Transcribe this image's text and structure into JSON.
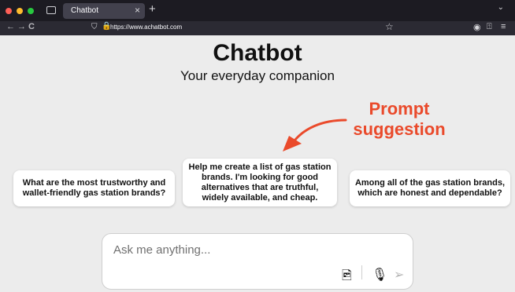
{
  "browser": {
    "tab_title": "Chatbot",
    "tab_close": "×",
    "new_tab": "+",
    "url": "https://www.achatbot.com",
    "traffic_lights": [
      "#fe5f57",
      "#febc2e",
      "#28c840"
    ],
    "nav_icons": [
      "back-arrow-icon",
      "forward-arrow-icon",
      "reload-icon"
    ],
    "icons": {
      "back": "←",
      "forward": "→",
      "reload": "C",
      "shield": "⛉",
      "lock": "🔒",
      "star": "☆",
      "account": "◉",
      "extensions": "⍐",
      "menu": "≡",
      "chevron": "⌄"
    }
  },
  "page": {
    "title": "Chatbot",
    "subtitle": "Your everyday companion",
    "annotation": "Prompt suggestion",
    "annotation_color": "#ea4a2b",
    "suggestions": [
      "What are the most trustworthy and wallet-friendly gas station brands?",
      "Help me create a list of gas station brands. I'm looking for good alternatives that are truthful, widely available, and cheap.",
      "Among all of the gas station brands, which are honest and dependable?"
    ],
    "input_placeholder": "Ask me anything...",
    "chat_icons": {
      "image": "🖻",
      "mic": "🎙",
      "send": "➢"
    }
  }
}
